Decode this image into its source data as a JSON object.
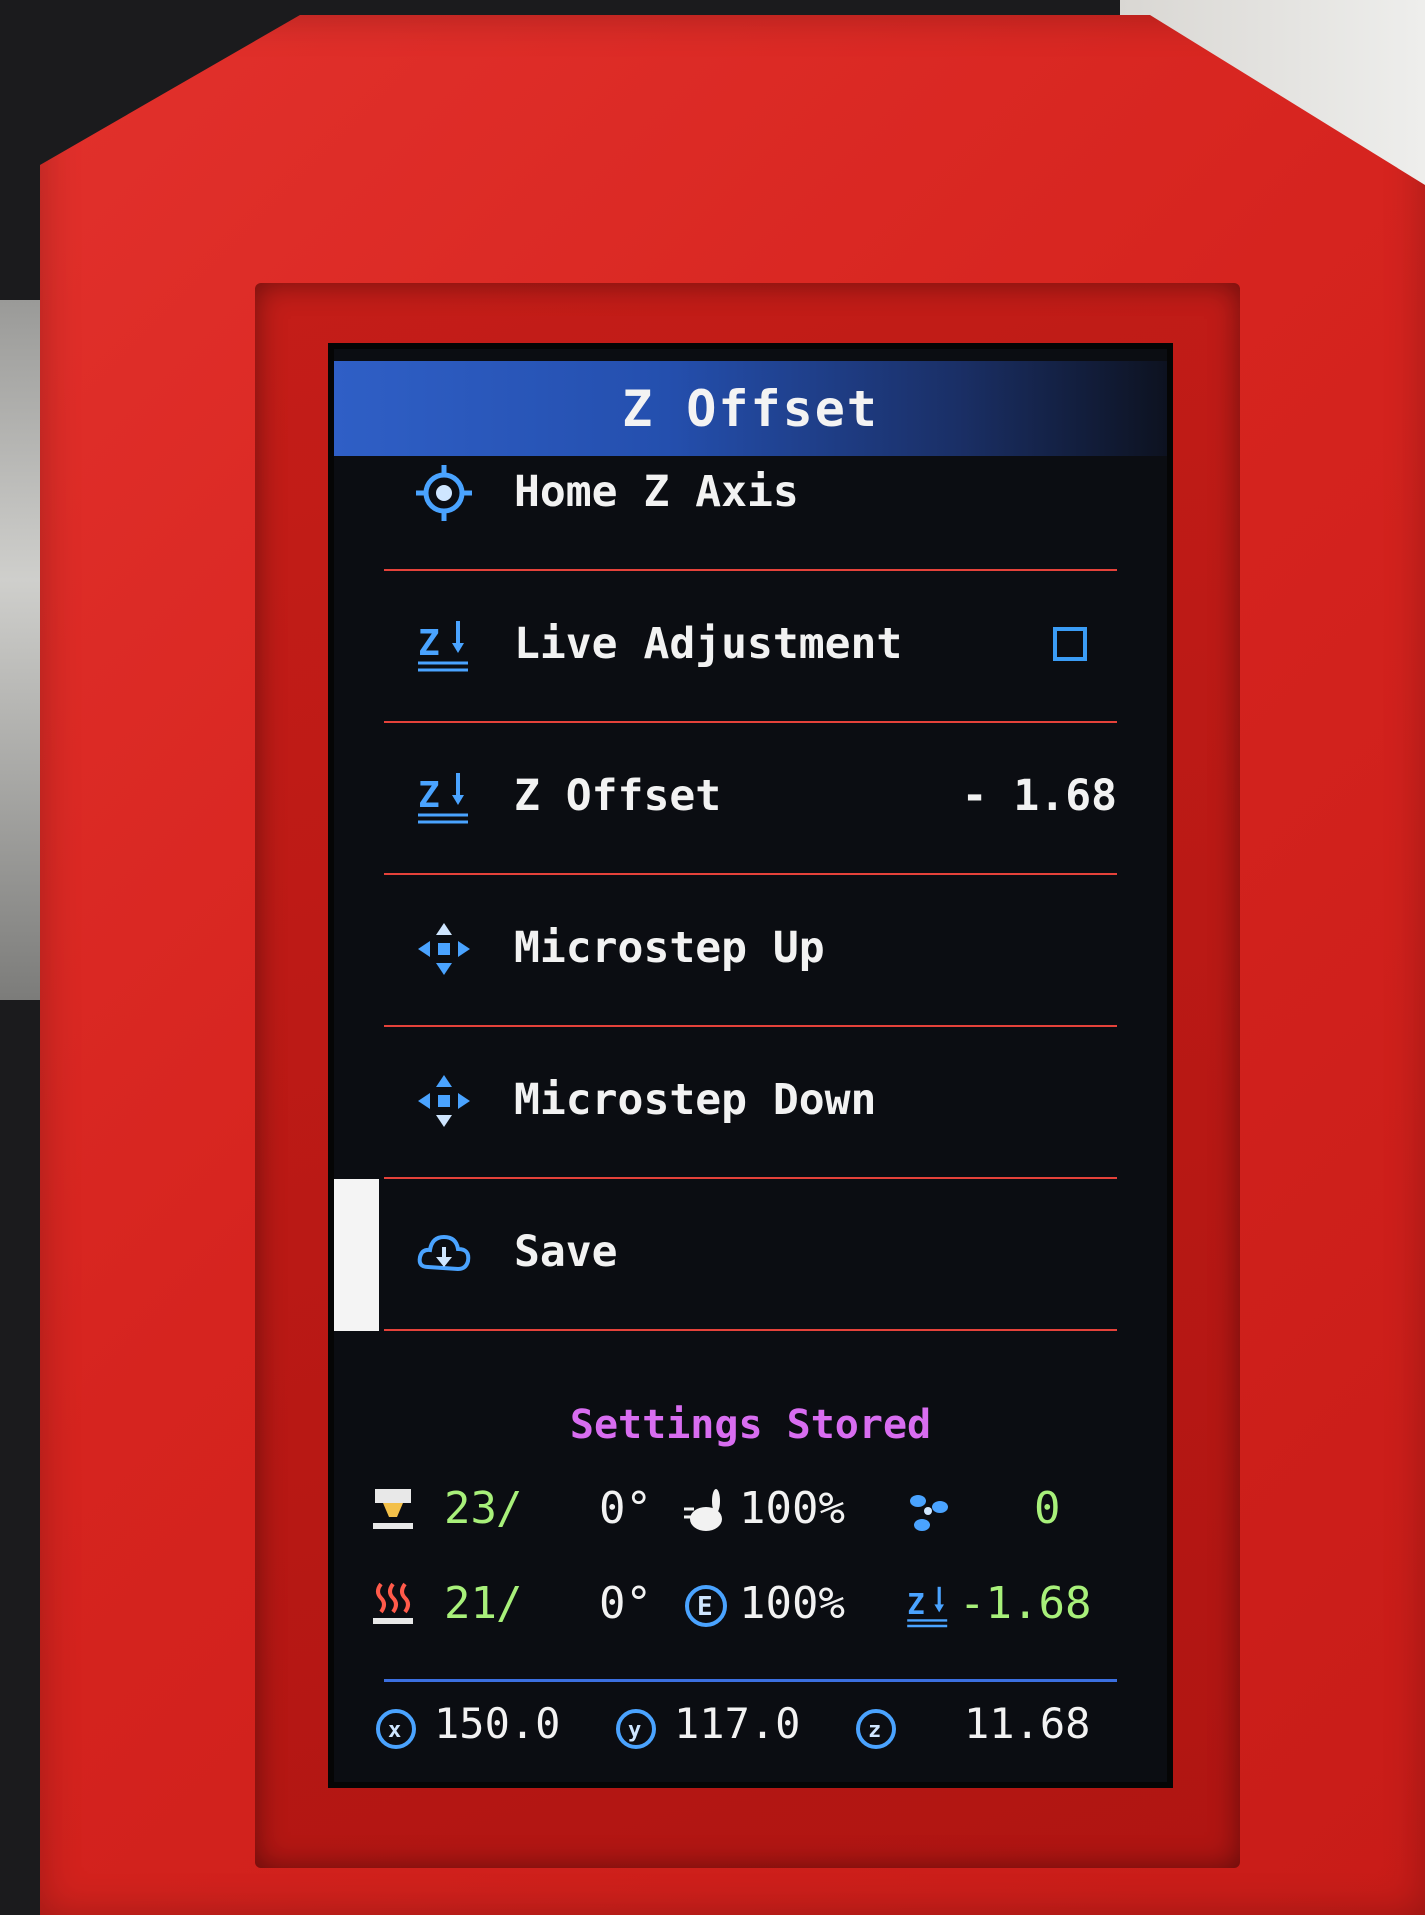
{
  "title": "Z Offset",
  "colors": {
    "accent": "#2f5fc6",
    "divider": "#e5423a",
    "status": "#d86df0",
    "value_green": "#a8f07a",
    "case_red": "#d6241f"
  },
  "menu": {
    "items": [
      {
        "label": "Home Z Axis",
        "icon": "home-target-icon"
      },
      {
        "label": "Live Adjustment",
        "icon": "z-offset-icon",
        "control": "checkbox",
        "checked": false
      },
      {
        "label": "Z Offset",
        "icon": "z-offset-icon",
        "value": "- 1.68"
      },
      {
        "label": "Microstep Up",
        "icon": "move-arrows-icon"
      },
      {
        "label": "Microstep Down",
        "icon": "move-arrows-icon"
      },
      {
        "label": "Save",
        "icon": "cloud-save-icon",
        "selected": true
      }
    ]
  },
  "status_message": "Settings Stored",
  "status": {
    "hotend": {
      "icon": "hotend-icon",
      "current": "23",
      "target": "0°"
    },
    "bed": {
      "icon": "heated-bed-icon",
      "current": "21",
      "target": "0°"
    },
    "speed": {
      "icon": "speed-rabbit-icon",
      "value": "100%"
    },
    "flow": {
      "icon": "extruder-e-icon",
      "value": "100%"
    },
    "fan": {
      "icon": "fan-icon",
      "value": "0"
    },
    "zoffset": {
      "icon": "z-offset-icon",
      "value": "-1.68"
    }
  },
  "coords": {
    "x": {
      "icon": "x-axis-icon",
      "value": "150.0"
    },
    "y": {
      "icon": "y-axis-icon",
      "value": "117.0"
    },
    "z": {
      "icon": "z-axis-icon",
      "value": "11.68"
    }
  }
}
